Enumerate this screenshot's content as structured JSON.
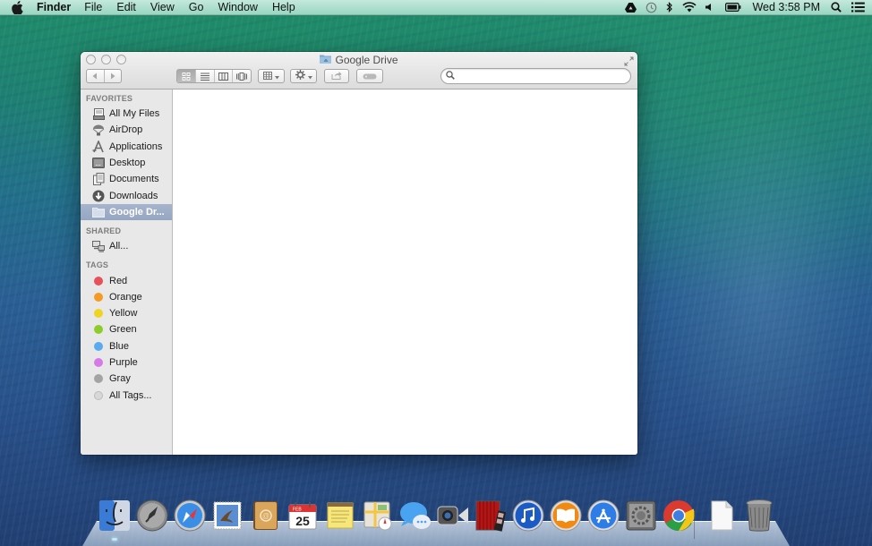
{
  "menubar": {
    "app_name": "Finder",
    "menus": [
      "File",
      "Edit",
      "View",
      "Go",
      "Window",
      "Help"
    ],
    "status_icons": [
      "google-drive-icon",
      "time-machine-icon",
      "bluetooth-icon",
      "wifi-icon",
      "volume-icon",
      "battery-icon"
    ],
    "clock": "Wed 3:58 PM",
    "spotlight_icon": "spotlight-search-icon",
    "notification_icon": "notification-center-icon"
  },
  "window": {
    "title": "Google Drive",
    "search": {
      "value": "",
      "placeholder": ""
    },
    "view_modes": [
      "icon",
      "list",
      "column",
      "cover-flow"
    ],
    "active_view": "icon",
    "sidebar": {
      "favorites_header": "FAVORITES",
      "favorites": [
        {
          "label": "All My Files",
          "icon": "all-my-files-icon"
        },
        {
          "label": "AirDrop",
          "icon": "airdrop-icon"
        },
        {
          "label": "Applications",
          "icon": "applications-icon"
        },
        {
          "label": "Desktop",
          "icon": "desktop-icon"
        },
        {
          "label": "Documents",
          "icon": "documents-icon"
        },
        {
          "label": "Downloads",
          "icon": "downloads-icon"
        },
        {
          "label": "Google Dr...",
          "icon": "folder-icon",
          "selected": true
        }
      ],
      "shared_header": "SHARED",
      "shared": [
        {
          "label": "All...",
          "icon": "network-icon"
        }
      ],
      "tags_header": "TAGS",
      "tags": [
        {
          "label": "Red",
          "color": "#e8505a"
        },
        {
          "label": "Orange",
          "color": "#f59a23"
        },
        {
          "label": "Yellow",
          "color": "#f0d421"
        },
        {
          "label": "Green",
          "color": "#8dcc2a"
        },
        {
          "label": "Blue",
          "color": "#5aaaf0"
        },
        {
          "label": "Purple",
          "color": "#d77ae8"
        },
        {
          "label": "Gray",
          "color": "#a4a4a4"
        },
        {
          "label": "All Tags...",
          "color": "#d8d8d8"
        }
      ]
    }
  },
  "dock": {
    "apps": [
      {
        "name": "Finder",
        "icon": "finder-icon",
        "running": true
      },
      {
        "name": "Launchpad",
        "icon": "launchpad-icon"
      },
      {
        "name": "Safari",
        "icon": "safari-icon"
      },
      {
        "name": "Mail",
        "icon": "mail-icon"
      },
      {
        "name": "Contacts",
        "icon": "contacts-icon"
      },
      {
        "name": "Calendar",
        "icon": "calendar-icon",
        "month": "FEB",
        "day": "25"
      },
      {
        "name": "Notes",
        "icon": "notes-icon"
      },
      {
        "name": "Maps",
        "icon": "maps-icon"
      },
      {
        "name": "Messages",
        "icon": "messages-icon"
      },
      {
        "name": "FaceTime",
        "icon": "facetime-icon"
      },
      {
        "name": "Photo Booth",
        "icon": "photo-booth-icon"
      },
      {
        "name": "iTunes",
        "icon": "itunes-icon"
      },
      {
        "name": "iBooks",
        "icon": "ibooks-icon"
      },
      {
        "name": "App Store",
        "icon": "app-store-icon"
      },
      {
        "name": "System Preferences",
        "icon": "system-preferences-icon"
      },
      {
        "name": "Google Chrome",
        "icon": "chrome-icon"
      }
    ],
    "right": [
      {
        "name": "Document",
        "icon": "document-stack-icon"
      },
      {
        "name": "Trash",
        "icon": "trash-icon"
      }
    ]
  }
}
